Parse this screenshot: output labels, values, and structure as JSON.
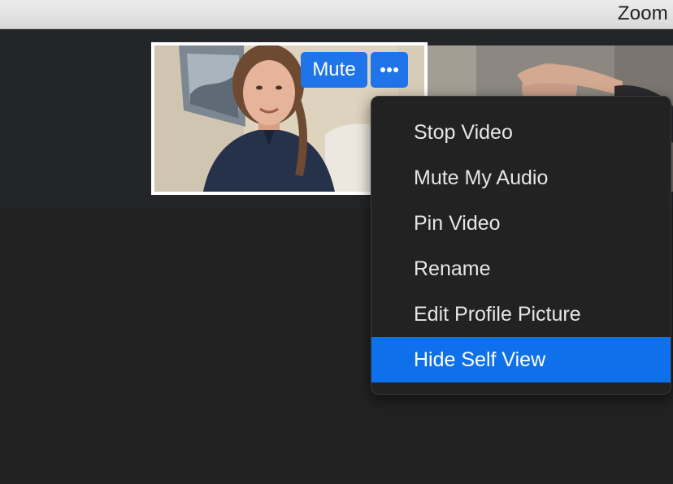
{
  "window": {
    "title": "Zoom"
  },
  "tile_controls": {
    "mute_label": "Mute",
    "more_icon": "ellipsis-icon"
  },
  "menu": {
    "items": [
      {
        "label": "Stop Video"
      },
      {
        "label": "Mute My Audio"
      },
      {
        "label": "Pin Video"
      },
      {
        "label": "Rename"
      },
      {
        "label": "Edit Profile Picture"
      },
      {
        "label": "Hide Self View"
      }
    ],
    "selected_label": "Hide Self View",
    "highlight_color": "#0e71eb"
  },
  "colors": {
    "accent": "#1e74e8",
    "background": "#222222"
  }
}
